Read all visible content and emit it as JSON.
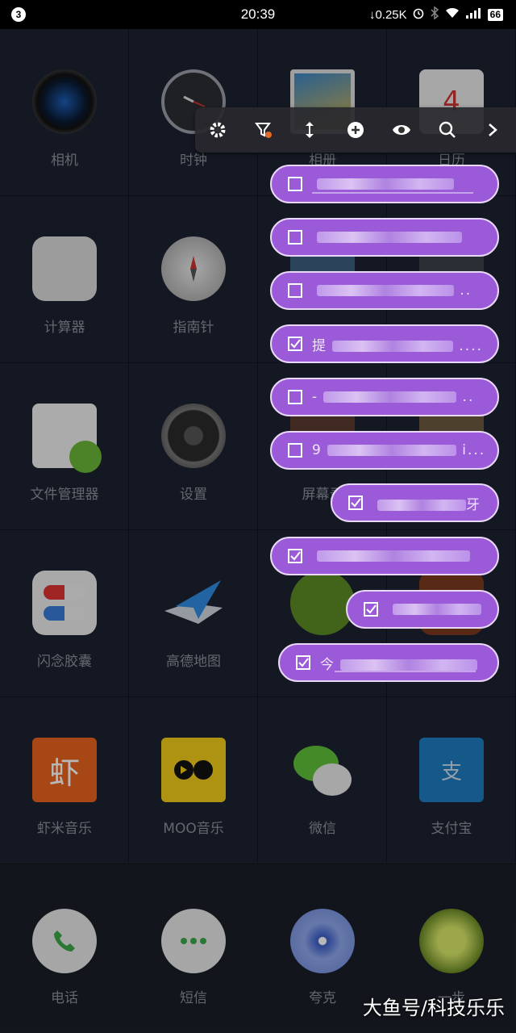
{
  "status_bar": {
    "notification_count": "3",
    "time": "20:39",
    "net_speed": "↓0.25K",
    "battery": "66"
  },
  "apps": [
    {
      "label": "相机",
      "icon": "camera-icon"
    },
    {
      "label": "时钟",
      "icon": "clock-icon"
    },
    {
      "label": "相册",
      "icon": "gallery-icon"
    },
    {
      "label": "日历",
      "icon": "calendar-icon"
    },
    {
      "label": "计算器",
      "icon": "calculator-icon"
    },
    {
      "label": "指南针",
      "icon": "compass-icon"
    },
    {
      "label": "",
      "icon": "app-icon"
    },
    {
      "label": "",
      "icon": "app-icon"
    },
    {
      "label": "文件管理器",
      "icon": "file-manager-icon"
    },
    {
      "label": "设置",
      "icon": "settings-gear-icon"
    },
    {
      "label": "屏幕录",
      "icon": "screen-recorder-icon"
    },
    {
      "label": "",
      "icon": "app-icon"
    },
    {
      "label": "闪念胶囊",
      "icon": "capsule-icon"
    },
    {
      "label": "高德地图",
      "icon": "map-icon"
    },
    {
      "label": "",
      "icon": "peas-icon"
    },
    {
      "label": "",
      "icon": "app-icon"
    },
    {
      "label": "虾米音乐",
      "icon": "xiami-music-icon"
    },
    {
      "label": "MOO音乐",
      "icon": "moo-music-icon"
    },
    {
      "label": "微信",
      "icon": "wechat-icon"
    },
    {
      "label": "支付宝",
      "icon": "alipay-icon"
    }
  ],
  "dock": [
    {
      "label": "电话",
      "icon": "phone-icon"
    },
    {
      "label": "短信",
      "icon": "messages-icon"
    },
    {
      "label": "夸克",
      "icon": "quark-browser-icon"
    },
    {
      "label": "一步",
      "icon": "shoe-icon"
    }
  ],
  "toolbar": {
    "buttons": [
      "settings-icon",
      "filter-icon",
      "sort-arrows-icon",
      "add-icon",
      "eye-icon",
      "search-icon",
      "chevron-right-icon"
    ]
  },
  "tasks": [
    {
      "checked": false,
      "text": "",
      "suffix": ""
    },
    {
      "checked": false,
      "text": "",
      "suffix": ""
    },
    {
      "checked": false,
      "text": "",
      "suffix": ".."
    },
    {
      "checked": true,
      "text": "提",
      "suffix": "...."
    },
    {
      "checked": false,
      "text": "-",
      "suffix": ".."
    },
    {
      "checked": false,
      "text": "9",
      "suffix": "i..."
    },
    {
      "checked": true,
      "text": "",
      "suffix": "牙"
    },
    {
      "checked": true,
      "text": "",
      "suffix": ""
    },
    {
      "checked": true,
      "text": "",
      "suffix": ""
    },
    {
      "checked": true,
      "text": "今",
      "suffix": ""
    }
  ],
  "colors": {
    "pill": "#9b5bd8",
    "pill_border": "#e9d8fa",
    "background": "#1c2029"
  },
  "watermark": "大鱼号/科技乐乐"
}
